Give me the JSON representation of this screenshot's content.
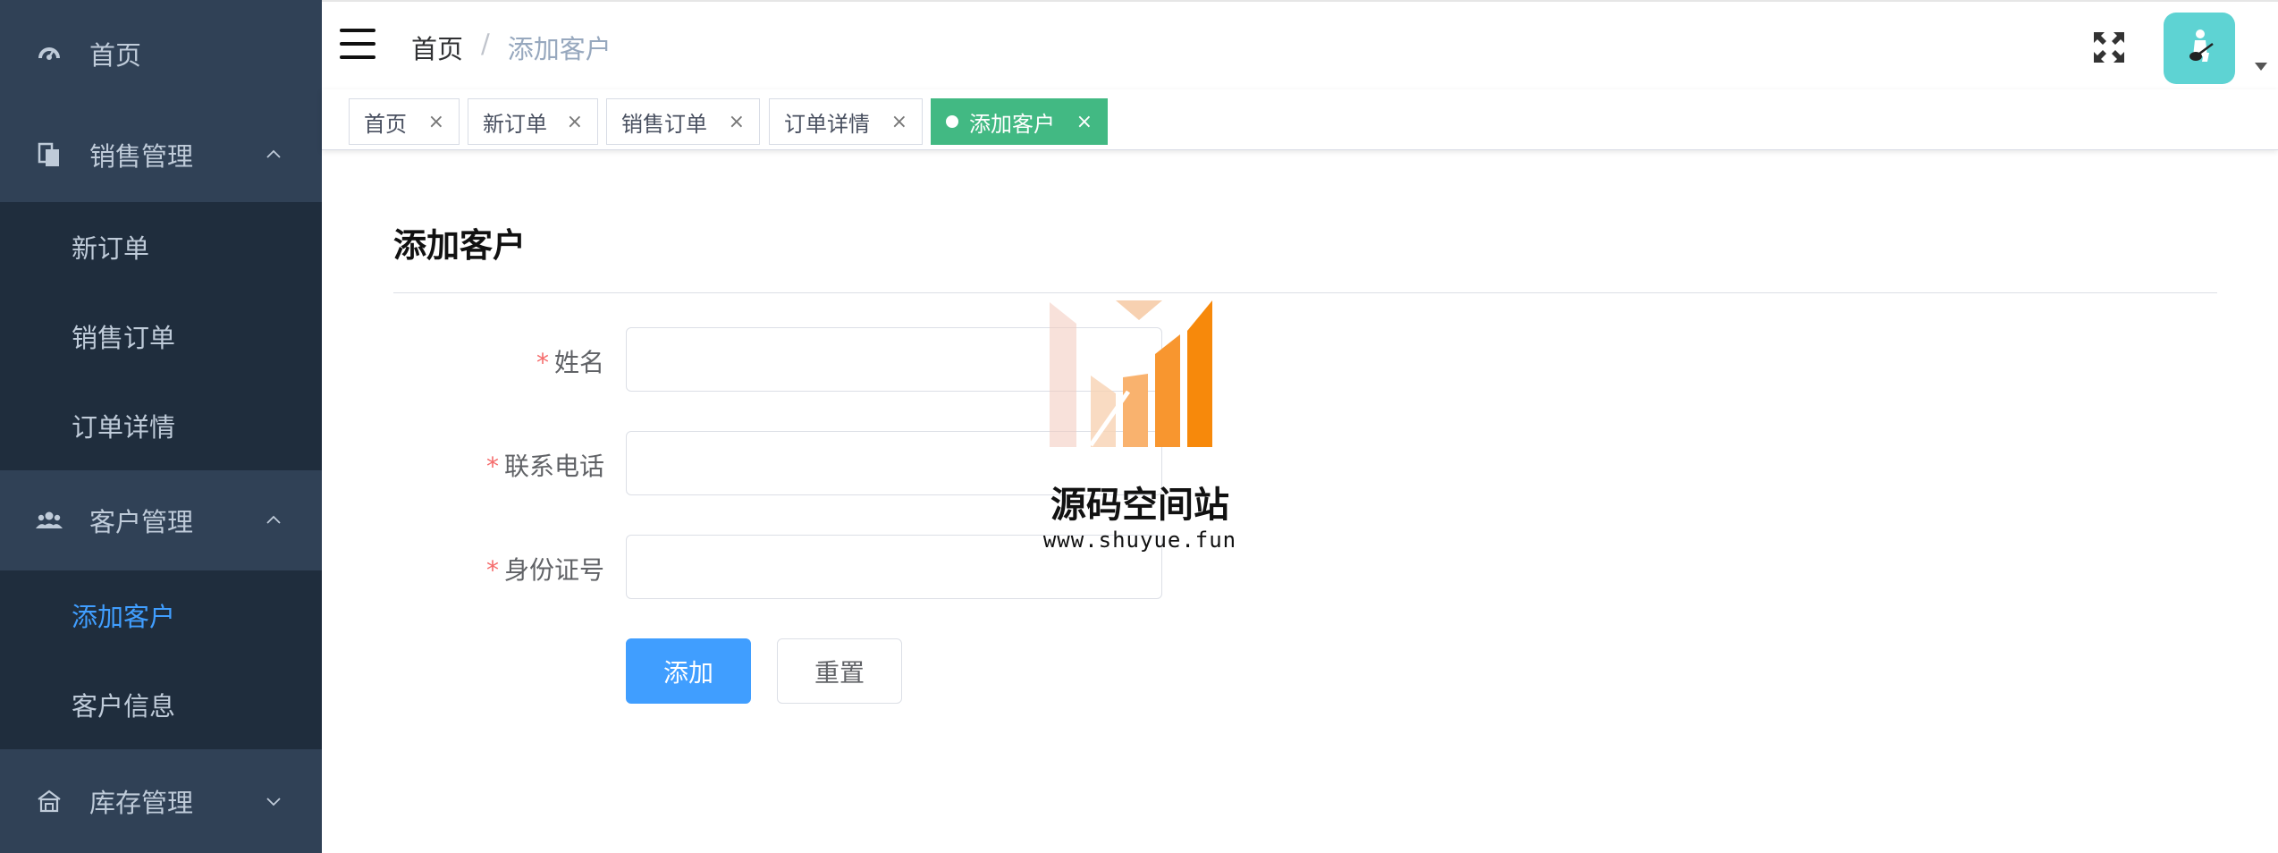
{
  "sidebar": {
    "home": "首页",
    "sales": "销售管理",
    "sales_items": [
      "新订单",
      "销售订单",
      "订单详情"
    ],
    "customers": "客户管理",
    "customer_items": [
      "添加客户",
      "客户信息"
    ],
    "inventory": "库存管理"
  },
  "navbar": {
    "breadcrumb_home": "首页",
    "breadcrumb_sep": "/",
    "breadcrumb_current": "添加客户"
  },
  "tags": [
    {
      "label": "首页",
      "close": "×"
    },
    {
      "label": "新订单",
      "close": "×"
    },
    {
      "label": "销售订单",
      "close": "×"
    },
    {
      "label": "订单详情",
      "close": "×"
    },
    {
      "label": "添加客户",
      "close": "×",
      "active": true
    }
  ],
  "page": {
    "title": "添加客户",
    "form": {
      "required_mark": "*",
      "name_label": "姓名",
      "phone_label": "联系电话",
      "id_label": "身份证号",
      "name_value": "",
      "phone_value": "",
      "id_value": "",
      "submit_label": "添加",
      "reset_label": "重置"
    }
  },
  "watermark": {
    "title": "源码空间站",
    "url": "www.shuyue.fun"
  },
  "colors": {
    "sidebar_bg": "#304156",
    "submenu_bg": "#1f2d3d",
    "active_menu": "#409eff",
    "tag_active": "#42b983",
    "primary": "#409eff",
    "required": "#f56c6c",
    "avatar_bg": "#5ed3d3"
  },
  "icons": {
    "home": "dashboard-icon",
    "sales": "documents-icon",
    "customers": "people-icon",
    "inventory": "warehouse-icon",
    "fullscreen": "fullscreen-icon",
    "menu": "hamburger-icon"
  }
}
